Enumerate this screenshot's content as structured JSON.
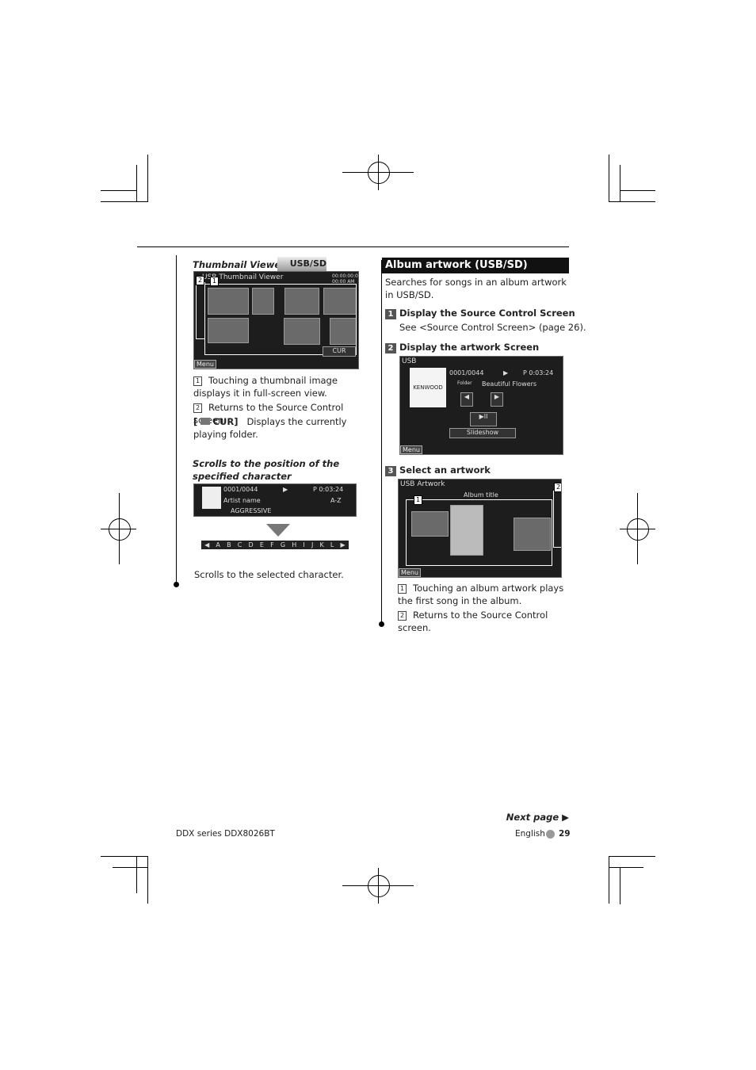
{
  "left": {
    "thumbnail_title": "Thumbnail Viewer",
    "usb_sd_badge": "USB/SD",
    "thumb_screen": {
      "title": "USB Thumbnail Viewer",
      "time": "00:00:00:00\n00:00 AM",
      "cur": "CUR",
      "menu": "Menu",
      "callout1": "1",
      "callout2": "2"
    },
    "items": [
      {
        "num": "1",
        "text": "Touching a thumbnail image displays it in full-screen view."
      },
      {
        "num": "2",
        "text": "Returns to the Source Control screen."
      }
    ],
    "cur_item": {
      "label": "CUR]",
      "bracket": "[",
      "text": "Displays the currently playing folder."
    },
    "scroll_title": "Scrolls to the position of the specified character",
    "scroll_screen": {
      "track": "0001/0044",
      "play": "▶",
      "time": "P  0:03:24",
      "artist": "Artist name",
      "az": "A-Z",
      "genre": "AGGRESSIVE"
    },
    "alphabet": [
      "◀",
      "A",
      "B",
      "C",
      "D",
      "E",
      "F",
      "G",
      "H",
      "I",
      "J",
      "K",
      "L",
      "▶"
    ],
    "scroll_caption": "Scrolls to the selected character."
  },
  "right": {
    "section_title": "Album artwork (USB/SD)",
    "intro": "Searches for songs in an album artwork in USB/SD.",
    "steps": [
      {
        "num": "1",
        "title": "Display the Source Control Screen",
        "text": "See <Source Control Screen> (page 26)."
      },
      {
        "num": "2",
        "title": "Display the artwork Screen"
      },
      {
        "num": "3",
        "title": "Select an artwork"
      }
    ],
    "source_screen": {
      "label": "USB",
      "track": "0001/0044",
      "play": "▶",
      "time": "P  0:03:24",
      "folder": "Folder",
      "song": "Beautiful Flowers",
      "logo": "KENWOOD",
      "slideshow": "Slideshow",
      "menu": "Menu"
    },
    "artwork_screen": {
      "title": "USB Artwork",
      "album": "Album title",
      "menu": "Menu",
      "callout1": "1",
      "callout2": "2"
    },
    "items": [
      {
        "num": "1",
        "text": "Touching an album artwork plays the first song in the album."
      },
      {
        "num": "2",
        "text": "Returns to the Source Control screen."
      }
    ]
  },
  "footer": {
    "next_page": "Next page ▶",
    "series": "DDX series   DDX8026BT",
    "language": "English",
    "page": "29"
  }
}
